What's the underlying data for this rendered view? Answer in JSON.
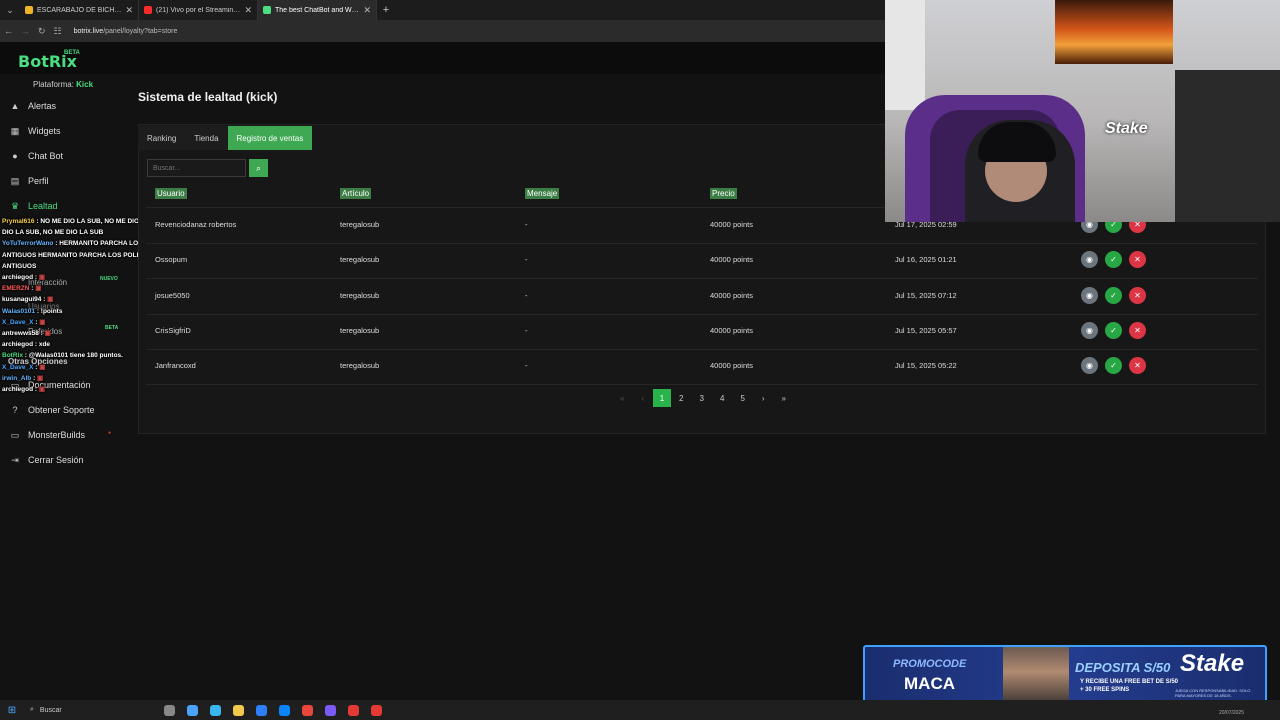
{
  "browser": {
    "tabs": [
      {
        "title": "ESCARABAJO DE BICHOS - Bus",
        "color": "#f0b429"
      },
      {
        "title": "(21) Vivo por el Streaming - You",
        "color": "#ff2a2a"
      },
      {
        "title": "The best ChatBot and Widgets",
        "color": "#4ade80"
      }
    ],
    "url_host": "botrix.live",
    "url_path": "/panel/loyalty?tab=store"
  },
  "app": {
    "logo": "BotRix",
    "logo_badge": "BETA",
    "platform_label": "Plataforma:",
    "platform_value": "Kick"
  },
  "sidebar": {
    "items": [
      {
        "label": "Alertas",
        "icon": "bell-icon",
        "glyph": "▲"
      },
      {
        "label": "Widgets",
        "icon": "grid-icon",
        "glyph": "▦"
      },
      {
        "label": "Chat Bot",
        "icon": "chat-icon",
        "glyph": "●"
      },
      {
        "label": "Perfil",
        "icon": "profile-icon",
        "glyph": "▤"
      },
      {
        "label": "Lealtad",
        "icon": "trophy-icon",
        "glyph": "♛"
      }
    ],
    "mid_items": {
      "interaccion": "Interacción",
      "nuevo": "NUEVO",
      "usuarios": "Usuarios",
      "referidos": "Referidos",
      "beta": "BETA",
      "otras": "Otras Opciones"
    },
    "bottom_items": [
      {
        "label": "Documentación",
        "icon": "book-icon",
        "glyph": "▭"
      },
      {
        "label": "Obtener Soporte",
        "icon": "help-icon",
        "glyph": "?"
      },
      {
        "label": "MonsterBuilds",
        "icon": "monitor-icon",
        "glyph": "▭"
      },
      {
        "label": "Cerrar Sesión",
        "icon": "logout-icon",
        "glyph": "⇥"
      }
    ]
  },
  "chat": [
    {
      "user": "Prymal616",
      "color": "#f7d14a",
      "text": "NO ME DIO LA SUB, NO ME DIO LA SUB, NO ME DIO LA SUB, NO ME DIO LA SUB, NO ME DIO LA SUB"
    },
    {
      "user": "YoTuTerrorWano",
      "color": "#66b3ff",
      "text": "HERMANITO PARCHA LOS POLLOS PS ESOS SON LOS MAS ANTIGUOS HERMANITO PARCHA LOS POLLOS PS ESOS SON LOS MAS ANTIGUOS"
    },
    {
      "user": "archiegod",
      "color": "#ffffff",
      "text": ""
    },
    {
      "user": "EMERZN",
      "color": "#ff5a5a",
      "text": ""
    },
    {
      "user": "kusanagui94",
      "color": "#ffffff",
      "text": ""
    },
    {
      "user": "Walas0101",
      "color": "#66b3ff",
      "text": "!points"
    },
    {
      "user": "X_Dave_X",
      "color": "#4aa3ff",
      "text": ""
    },
    {
      "user": "antrewws58",
      "color": "#ffffff",
      "text": ""
    },
    {
      "user": "archiegod",
      "color": "#ffffff",
      "text": "xde"
    },
    {
      "user": "BotRix",
      "color": "#4ade80",
      "text": "@Walas0101 tiene 180 puntos."
    },
    {
      "user": "X_Dave_X",
      "color": "#4aa3ff",
      "text": ""
    },
    {
      "user": "irwin_Alb",
      "color": "#66b3ff",
      "text": ""
    },
    {
      "user": "archiegod",
      "color": "#ffffff",
      "text": ""
    }
  ],
  "page": {
    "title": "Sistema de lealtad (kick)",
    "tabs": [
      {
        "label": "Ranking",
        "active": false
      },
      {
        "label": "Tienda",
        "active": false
      },
      {
        "label": "Registro de ventas",
        "active": true
      }
    ],
    "search_placeholder": "Buscar...",
    "columns": [
      "Usuario",
      "Artículo",
      "Mensaje",
      "Precio"
    ],
    "rows": [
      {
        "user": "Revenciodanaz robertos",
        "item": "teregalosub",
        "message": "-",
        "price": "40000 points",
        "date": "Jul 17, 2025 02:59"
      },
      {
        "user": "Ossopum",
        "item": "teregalosub",
        "message": "-",
        "price": "40000 points",
        "date": "Jul 16, 2025 01:21"
      },
      {
        "user": "josue5050",
        "item": "teregalosub",
        "message": "-",
        "price": "40000 points",
        "date": "Jul 15, 2025 07:12"
      },
      {
        "user": "CrisSigfriD",
        "item": "teregalosub",
        "message": "-",
        "price": "40000 points",
        "date": "Jul 15, 2025 05:57"
      },
      {
        "user": "Janfrancoxd",
        "item": "teregalosub",
        "message": "-",
        "price": "40000 points",
        "date": "Jul 15, 2025 05:22"
      }
    ],
    "pagination": [
      "«",
      "‹",
      "1",
      "2",
      "3",
      "4",
      "5",
      "›",
      "»"
    ],
    "current_page": "1"
  },
  "overlay": {
    "webcam_brand": "Stake",
    "ad": {
      "promo": "PROMOCODE",
      "code": "MACA",
      "deposit": "DEPOSITA S/50",
      "sub": "Y RECIBE UNA FREE BET DE S/50 + 30 FREE SPINS",
      "brand": "Stake",
      "fine": "JUEGA CON RESPONSABILIDAD. SOLO PARA MAYORES DE 18 AÑOS."
    }
  },
  "taskbar": {
    "search_label": "Buscar",
    "clock": "20/07/2025",
    "apps": [
      "#888",
      "#4aa3ff",
      "#3ab7f0",
      "#f2c94c",
      "#2d7ff9",
      "#0a84ff",
      "#e9473b",
      "#7a5af8",
      "#e53935",
      "#e53935"
    ]
  }
}
